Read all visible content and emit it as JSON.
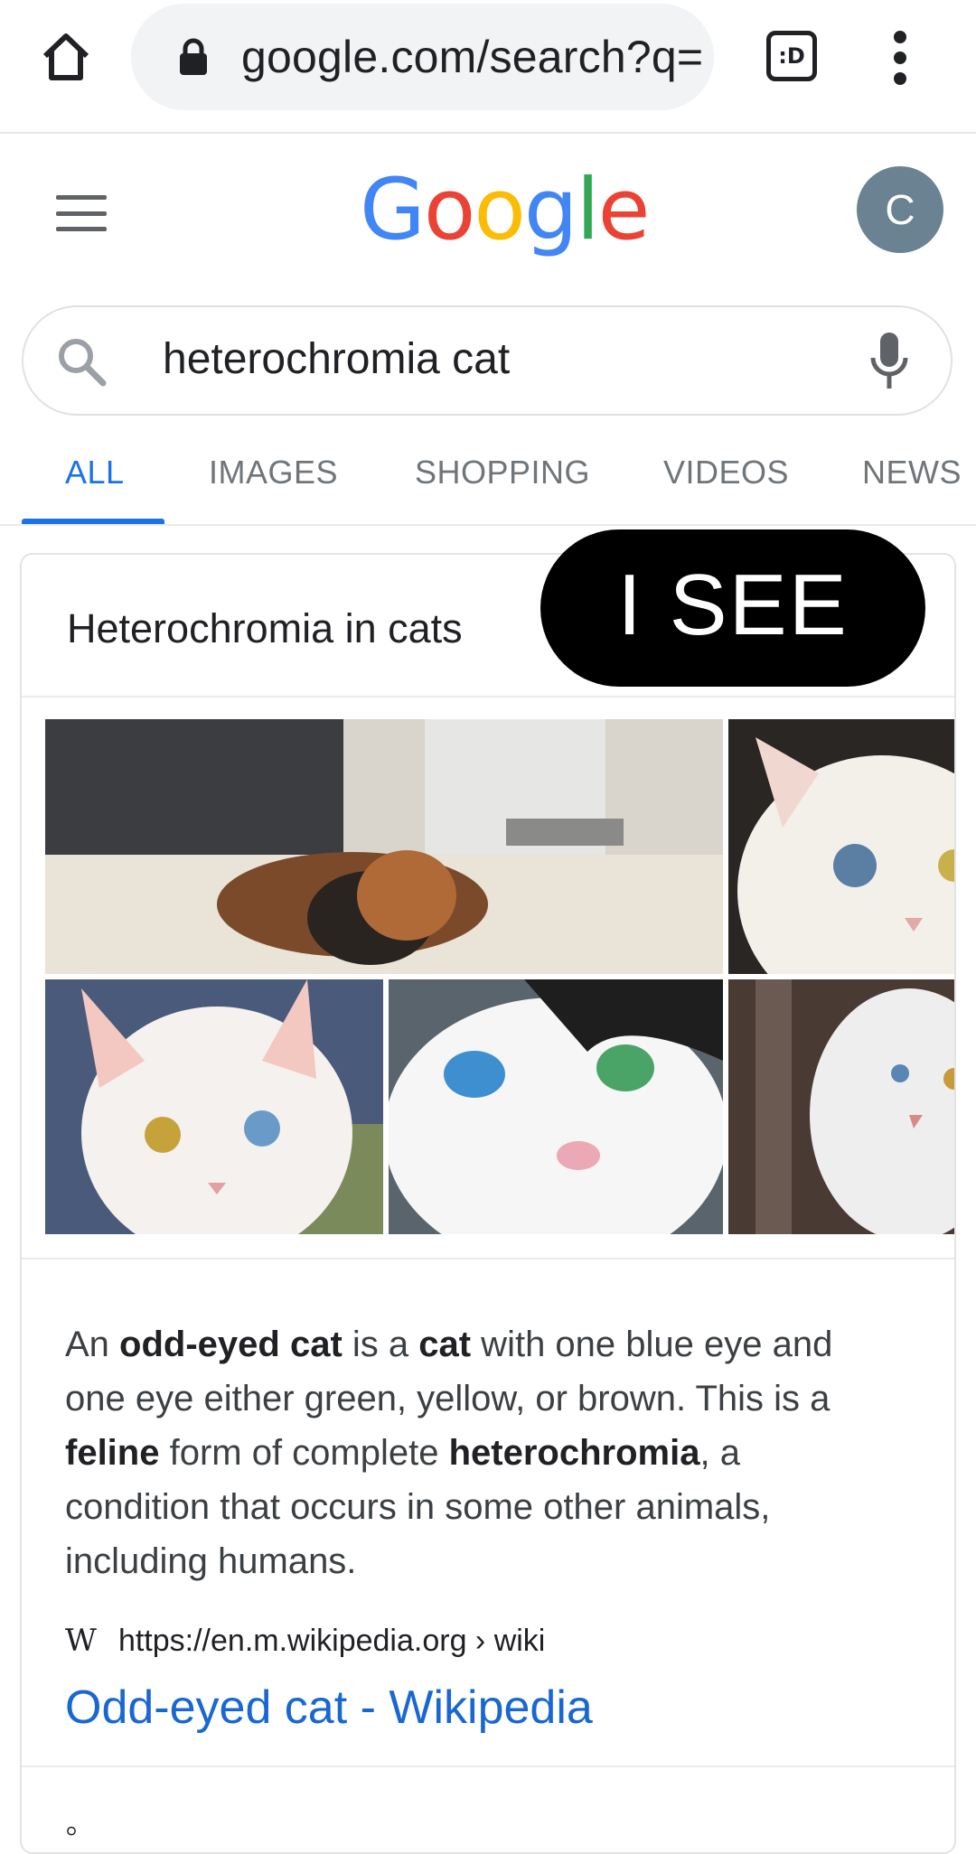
{
  "browser": {
    "url": "google.com/search?q=",
    "tabs_icon_label": ":D"
  },
  "header": {
    "logo_letters": [
      {
        "ch": "G",
        "color": "#4285f4"
      },
      {
        "ch": "o",
        "color": "#ea4335"
      },
      {
        "ch": "o",
        "color": "#fbbc05"
      },
      {
        "ch": "g",
        "color": "#4285f4"
      },
      {
        "ch": "l",
        "color": "#34a853"
      },
      {
        "ch": "e",
        "color": "#ea4335"
      }
    ],
    "avatar_letter": "C"
  },
  "search": {
    "query": "heterochromia cat"
  },
  "tabs": [
    {
      "label": "ALL",
      "active": true
    },
    {
      "label": "IMAGES",
      "active": false
    },
    {
      "label": "SHOPPING",
      "active": false
    },
    {
      "label": "VIDEOS",
      "active": false
    },
    {
      "label": "NEWS",
      "active": false
    }
  ],
  "card": {
    "title": "Heterochromia in cats",
    "overlay_text": "I SEE",
    "snippet_parts": [
      {
        "t": "An ",
        "b": false
      },
      {
        "t": "odd-eyed cat",
        "b": true
      },
      {
        "t": " is a ",
        "b": false
      },
      {
        "t": "cat",
        "b": true
      },
      {
        "t": " with one blue eye and one eye either green, yellow, or brown. This is a ",
        "b": false
      },
      {
        "t": "feline",
        "b": true
      },
      {
        "t": " form of complete ",
        "b": false
      },
      {
        "t": "heterochromia",
        "b": true
      },
      {
        "t": ", a condition that occurs in some other animals, including humans.",
        "b": false
      }
    ],
    "source_icon": "W",
    "source_url": "https://en.m.wikipedia.org › wiki",
    "result_title": "Odd-eyed cat - Wikipedia"
  },
  "colors": {
    "accent": "#1a73e8",
    "link": "#1967d2"
  }
}
